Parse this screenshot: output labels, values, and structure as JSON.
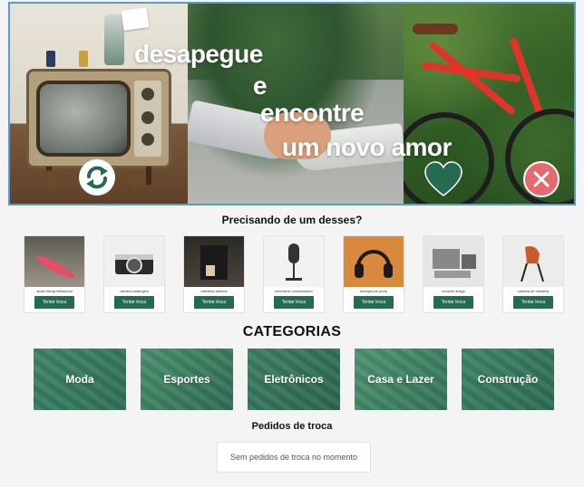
{
  "hero": {
    "line1": "desapegue",
    "line2": "e",
    "line3": "encontre",
    "line4": "um novo amor",
    "swap_icon": "swap-arrows-icon",
    "like_icon": "heart-icon",
    "close_icon": "close-icon",
    "colors": {
      "accent": "#256b52",
      "close": "#e36a70",
      "border": "#5b9bd5"
    }
  },
  "products": {
    "title": "Precisando de um desses?",
    "items": [
      {
        "name": "skate semiprofissional",
        "button": "Tentar troca"
      },
      {
        "name": "câmera analógica",
        "button": "Tentar troca"
      },
      {
        "name": "cafeteira elétrica",
        "button": "Tentar troca"
      },
      {
        "name": "microfone condensador",
        "button": "Tentar troca"
      },
      {
        "name": "headphone preto",
        "button": "Tentar troca"
      },
      {
        "name": "console antigo",
        "button": "Tentar troca"
      },
      {
        "name": "cadeira de madeira",
        "button": "Tentar troca"
      }
    ]
  },
  "categories": {
    "title": "CATEGORIAS",
    "items": [
      {
        "label": "Moda"
      },
      {
        "label": "Esportes"
      },
      {
        "label": "Eletrônicos"
      },
      {
        "label": "Casa e Lazer"
      },
      {
        "label": "Construção"
      }
    ]
  },
  "requests": {
    "title": "Pedidos de troca",
    "empty_message": "Sem pedidos de troca no momento"
  }
}
